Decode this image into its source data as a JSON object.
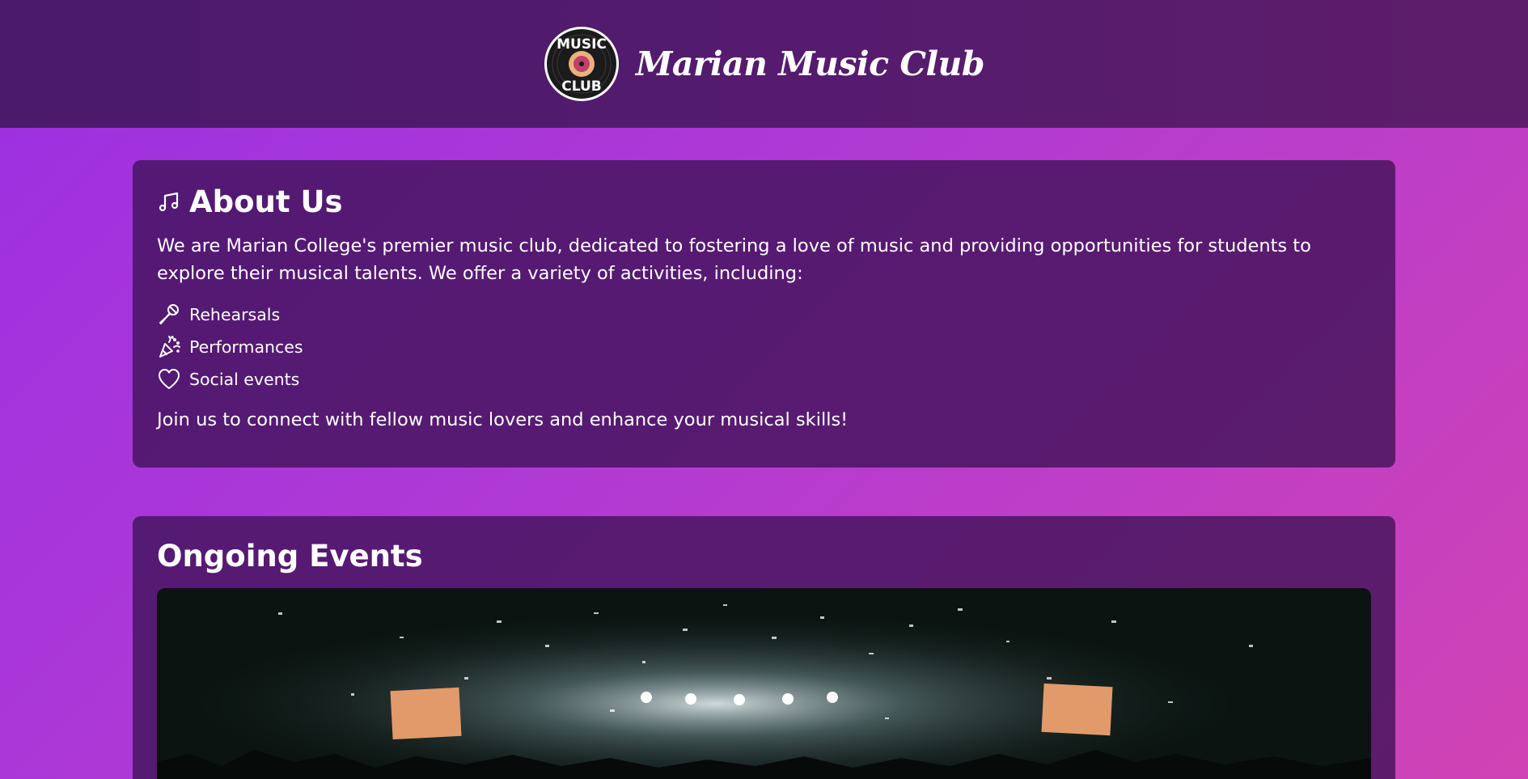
{
  "header": {
    "title": "Marian Music Club",
    "logo": {
      "text_top": "MUSIC",
      "text_bottom": "CLUB",
      "icon": "vinyl-record-logo"
    }
  },
  "about": {
    "title": "About Us",
    "title_icon": "music-note-icon",
    "intro": "We are Marian College's premier music club, dedicated to fostering a love of music and providing opportunities for students to explore their musical talents. We offer a variety of activities, including:",
    "activities": [
      {
        "label": "Rehearsals",
        "icon": "microphone-icon"
      },
      {
        "label": "Performances",
        "icon": "party-popper-icon"
      },
      {
        "label": "Social events",
        "icon": "heart-icon"
      }
    ],
    "outro": "Join us to connect with fellow music lovers and enhance your musical skills!"
  },
  "events": {
    "title": "Ongoing Events",
    "image_icon": "concert-photo"
  },
  "colors": {
    "background_start": "#9b2fe2",
    "background_end": "#d043b4",
    "header_bg": "#4a1a6b",
    "card_bg": "#3e1256",
    "text": "#ffffff"
  }
}
